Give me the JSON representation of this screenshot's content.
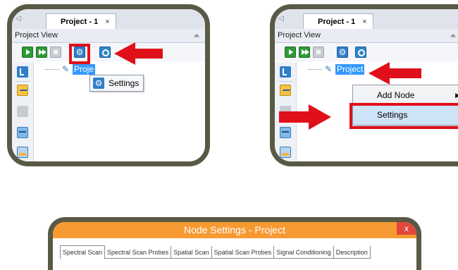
{
  "left_panel": {
    "tab_label": "Project - 1",
    "tab_close": "×",
    "pane_title": "Project View",
    "pin_glyph": "⩕",
    "tree_node_label": "Proje",
    "tooltip_label": "Settings",
    "settings_icon_glyph": "⚙"
  },
  "right_panel": {
    "tab_label": "Project - 1",
    "tab_close": "×",
    "pane_title": "Project View",
    "pin_glyph": "⩕",
    "tree_node_label": "Project",
    "settings_icon_glyph": "⚙",
    "context_menu": {
      "items": [
        "Add Node",
        "Settings"
      ],
      "submenu_arrow": "▶"
    }
  },
  "node_settings": {
    "title": "Node Settings - Project",
    "close": "x",
    "tabs": [
      "Spectral Scan",
      "Spectral Scan Probes",
      "Spatial Scan",
      "Spatial Scan Probes",
      "Signal Conditioning",
      "Description"
    ]
  },
  "colors": {
    "annotation_red": "#e0101a",
    "frame": "#5a5946",
    "title_orange": "#f79a32",
    "selection_blue": "#3399ff"
  }
}
